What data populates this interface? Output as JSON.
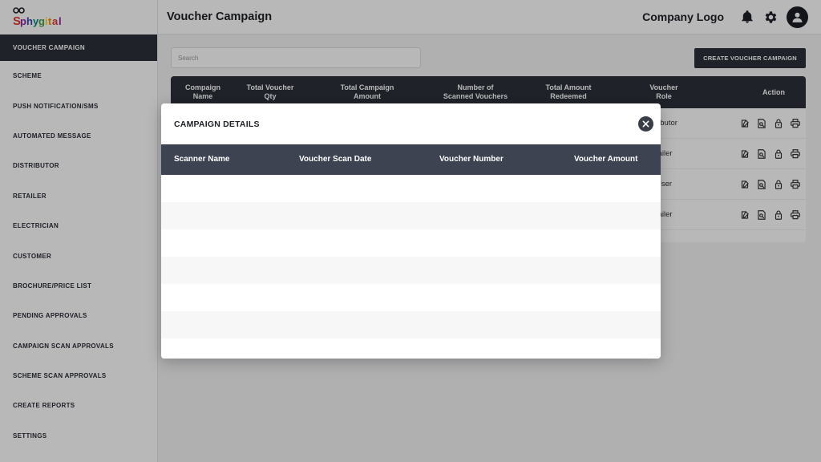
{
  "brand": {
    "logo_text": "Sphygital",
    "accent": "#2c3039"
  },
  "sidebar": {
    "items": [
      {
        "label": "VOUCHER CAMPAIGN",
        "active": true
      },
      {
        "label": "SCHEME"
      },
      {
        "label": "PUSH NOTIFICATION/SMS"
      },
      {
        "label": "AUTOMATED MESSAGE"
      },
      {
        "label": "DISTRIBUTOR"
      },
      {
        "label": "RETAILER"
      },
      {
        "label": "ELECTRICIAN"
      },
      {
        "label": "CUSTOMER"
      },
      {
        "label": "BROCHURE/PRICE LIST"
      },
      {
        "label": "PENDING APPROVALS"
      },
      {
        "label": "CAMPAIGN SCAN APPROVALS"
      },
      {
        "label": "SCHEME SCAN APPROVALS"
      },
      {
        "label": "CREATE REPORTS"
      },
      {
        "label": "SETTINGS"
      }
    ]
  },
  "header": {
    "title": "Voucher Campaign",
    "company_logo": "Company Logo",
    "icons": [
      "bell-icon",
      "gear-icon",
      "user-avatar-icon"
    ]
  },
  "main": {
    "search_placeholder": "Search",
    "create_button": "CREATE VOUCHER CAMPAIGN",
    "table": {
      "headers": [
        "Compaign\nName",
        "Total Voucher\nQty",
        "Total Campaign\nAmount",
        "Number of\nScanned Vouchers",
        "Total Amount\nRedeemed",
        "Voucher\nRole",
        "Action"
      ],
      "rows": [
        {
          "role_visible": "ributor"
        },
        {
          "role_visible": "tailer"
        },
        {
          "role_visible": "User"
        },
        {
          "role_visible": "tailer"
        }
      ],
      "action_icons": [
        "edit-icon",
        "view-document-icon",
        "lock-icon",
        "print-icon"
      ]
    }
  },
  "modal": {
    "title": "CAMPAIGN DETAILS",
    "close_icon": "close-icon",
    "columns": [
      "Scanner Name",
      "Voucher Scan Date",
      "Voucher Number",
      "Voucher Amount"
    ],
    "empty_rows": 7
  }
}
